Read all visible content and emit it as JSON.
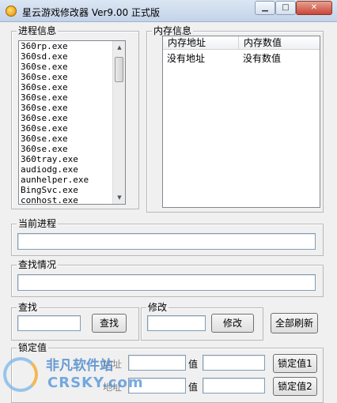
{
  "window": {
    "title": "星云游戏修改器 Ver9.00 正式版",
    "minimize_glyph": "▁",
    "maximize_glyph": "□",
    "close_glyph": "✕"
  },
  "process_panel": {
    "label": "进程信息",
    "items": [
      "360rp.exe",
      "360sd.exe",
      "360se.exe",
      "360se.exe",
      "360se.exe",
      "360se.exe",
      "360se.exe",
      "360se.exe",
      "360se.exe",
      "360se.exe",
      "360se.exe",
      "360tray.exe",
      "audiodg.exe",
      "aunhelper.exe",
      "BingSvc.exe",
      "conhost.exe"
    ],
    "scroll_up_glyph": "▲",
    "scroll_down_glyph": "▼"
  },
  "memory_panel": {
    "label": "内存信息",
    "columns": [
      "内存地址",
      "内存数值"
    ],
    "rows": [
      [
        "没有地址",
        "没有数值"
      ]
    ]
  },
  "current_process": {
    "label": "当前进程",
    "value": ""
  },
  "search_status": {
    "label": "查找情况",
    "value": ""
  },
  "search": {
    "label": "查找",
    "value": "",
    "button": "查找"
  },
  "modify": {
    "label": "修改",
    "value": "",
    "button": "修改"
  },
  "refresh_all_button": "全部刷新",
  "lock": {
    "label": "锁定值",
    "address_label": "地址",
    "value_label": "值",
    "buttons": [
      "锁定值1",
      "锁定值2"
    ]
  },
  "watermark": {
    "top": "非凡软件站",
    "bottom": "CRSKY.com"
  }
}
